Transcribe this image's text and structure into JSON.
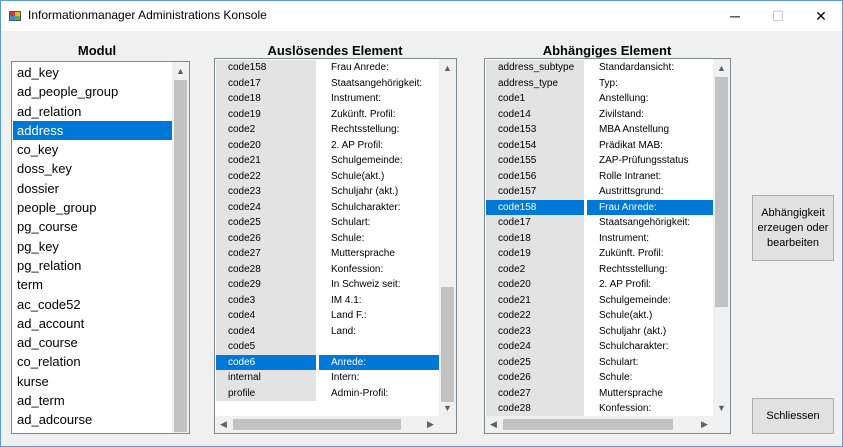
{
  "window": {
    "title": "Informationmanager Administrations Konsole",
    "controls": {
      "minimize": "─",
      "maximize": "☐",
      "close": "✕"
    }
  },
  "headers": {
    "modul": "Modul",
    "ausloesend": "Auslösendes Element",
    "abhaengig": "Abhängiges Element"
  },
  "modul_list": {
    "items": [
      "ad_key",
      "ad_people_group",
      "ad_relation",
      "address",
      "co_key",
      "doss_key",
      "dossier",
      "people_group",
      "pg_course",
      "pg_key",
      "pg_relation",
      "term",
      "ac_code52",
      "ad_account",
      "ad_course",
      "co_relation",
      "kurse",
      "ad_term",
      "ad_adcourse"
    ],
    "selected": "address"
  },
  "ausloesend_grid": {
    "rows": [
      {
        "key": "code158",
        "label": "Frau Anrede:"
      },
      {
        "key": "code17",
        "label": "Staatsangehörigkeit:"
      },
      {
        "key": "code18",
        "label": "Instrument:"
      },
      {
        "key": "code19",
        "label": "Zukünft. Profil:"
      },
      {
        "key": "code2",
        "label": "Rechtsstellung:"
      },
      {
        "key": "code20",
        "label": "2. AP Profil:"
      },
      {
        "key": "code21",
        "label": "Schulgemeinde:"
      },
      {
        "key": "code22",
        "label": "Schule(akt.)"
      },
      {
        "key": "code23",
        "label": "Schuljahr (akt.)"
      },
      {
        "key": "code24",
        "label": "Schulcharakter:"
      },
      {
        "key": "code25",
        "label": "Schulart:"
      },
      {
        "key": "code26",
        "label": "Schule:"
      },
      {
        "key": "code27",
        "label": "Muttersprache"
      },
      {
        "key": "code28",
        "label": "Konfession:"
      },
      {
        "key": "code29",
        "label": "In Schweiz seit:"
      },
      {
        "key": "code3",
        "label": "IM 4.1:"
      },
      {
        "key": "code4",
        "label": "Land F.:"
      },
      {
        "key": "code4",
        "label": "Land:"
      },
      {
        "key": "code5",
        "label": ""
      },
      {
        "key": "code6",
        "label": "Anrede:"
      },
      {
        "key": "internal",
        "label": "Intern:"
      },
      {
        "key": "profile",
        "label": "Admin-Profil:"
      }
    ],
    "selected_index": 19
  },
  "abhaengig_grid": {
    "rows": [
      {
        "key": "address_subtype",
        "label": "Standardansicht:"
      },
      {
        "key": "address_type",
        "label": "Typ:"
      },
      {
        "key": "code1",
        "label": "Anstellung:"
      },
      {
        "key": "code14",
        "label": "Zivilstand:"
      },
      {
        "key": "code153",
        "label": "MBA Anstellung"
      },
      {
        "key": "code154",
        "label": "Prädikat MAB:"
      },
      {
        "key": "code155",
        "label": "ZAP-Prüfungsstatus"
      },
      {
        "key": "code156",
        "label": "Rolle Intranet:"
      },
      {
        "key": "code157",
        "label": "Austrittsgrund:"
      },
      {
        "key": "code158",
        "label": "Frau Anrede:"
      },
      {
        "key": "code17",
        "label": "Staatsangehörigkeit:"
      },
      {
        "key": "code18",
        "label": "Instrument:"
      },
      {
        "key": "code19",
        "label": "Zukünft. Profil:"
      },
      {
        "key": "code2",
        "label": "Rechtsstellung:"
      },
      {
        "key": "code20",
        "label": "2. AP Profil:"
      },
      {
        "key": "code21",
        "label": "Schulgemeinde:"
      },
      {
        "key": "code22",
        "label": "Schule(akt.)"
      },
      {
        "key": "code23",
        "label": "Schuljahr (akt.)"
      },
      {
        "key": "code24",
        "label": "Schulcharakter:"
      },
      {
        "key": "code25",
        "label": "Schulart:"
      },
      {
        "key": "code26",
        "label": "Schule:"
      },
      {
        "key": "code27",
        "label": "Muttersprache"
      },
      {
        "key": "code28",
        "label": "Konfession:"
      }
    ],
    "selected_index": 9
  },
  "buttons": {
    "abhaengigkeit": "Abhängigkeit erzeugen oder bearbeiten",
    "schliessen": "Schliessen"
  },
  "scroll_arrows": {
    "up": "▲",
    "down": "▼",
    "left": "◀",
    "right": "▶"
  }
}
